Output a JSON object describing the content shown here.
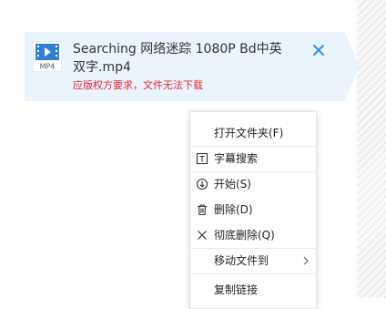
{
  "download_item": {
    "format_badge": "MP4",
    "title": "Searching 网络迷踪 1080P Bd中英双字.mp4",
    "status": "应版权方要求，文件无法下载",
    "icon": "video-file-icon",
    "close_icon": "close-icon"
  },
  "colors": {
    "card_background": "#eaf4fe",
    "status_red": "#e02a2a",
    "accent_blue": "#3a8ee6"
  },
  "context_menu": {
    "items": [
      {
        "label": "打开文件夹(F)",
        "icon": ""
      },
      {
        "label": "字幕搜索",
        "icon": "subtitle-icon"
      },
      {
        "label": "开始(S)",
        "icon": "download-circle-icon"
      },
      {
        "label": "删除(D)",
        "icon": "trash-icon"
      },
      {
        "label": "彻底删除(Q)",
        "icon": "x-icon"
      },
      {
        "label": "移动文件到",
        "icon": "",
        "submenu_icon": "chevron-right-icon"
      },
      {
        "label": "复制链接",
        "icon": ""
      }
    ]
  }
}
